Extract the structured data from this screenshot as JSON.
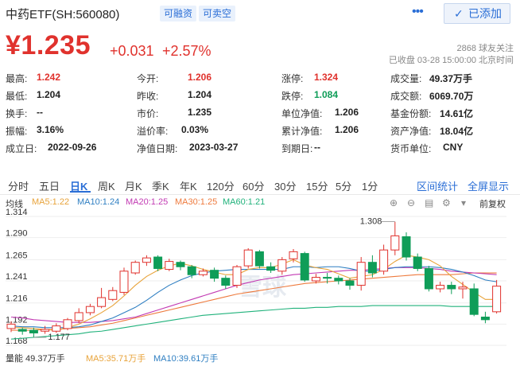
{
  "header": {
    "title": "中药ETF(SH:560080)",
    "tag_margin": "可融资",
    "tag_short": "可卖空",
    "more_icon": "more-icon",
    "added_label": "已添加"
  },
  "quote": {
    "price": "¥1.235",
    "change": "+0.031",
    "change_pct": "+2.57%",
    "followers": "2868 球友关注",
    "status": "已收盘 03-28 15:00:00 北京时间"
  },
  "stats": [
    {
      "label": "最高:",
      "value": "1.242",
      "tone": "red"
    },
    {
      "label": "今开:",
      "value": "1.206",
      "tone": "red"
    },
    {
      "label": "涨停:",
      "value": "1.324",
      "tone": "red"
    },
    {
      "label": "成交量:",
      "value": "49.37万手",
      "tone": "dark"
    },
    {
      "label": "最低:",
      "value": "1.204",
      "tone": "dark"
    },
    {
      "label": "昨收:",
      "value": "1.204",
      "tone": "dark"
    },
    {
      "label": "跌停:",
      "value": "1.084",
      "tone": "green"
    },
    {
      "label": "成交额:",
      "value": "6069.70万",
      "tone": "dark"
    },
    {
      "label": "换手:",
      "value": "--",
      "tone": "dark"
    },
    {
      "label": "市价:",
      "value": "1.235",
      "tone": "dark"
    },
    {
      "label": "单位净值:",
      "value": "1.206",
      "tone": "dark"
    },
    {
      "label": "基金份额:",
      "value": "14.61亿",
      "tone": "dark"
    },
    {
      "label": "振幅:",
      "value": "3.16%",
      "tone": "dark"
    },
    {
      "label": "溢价率:",
      "value": "0.03%",
      "tone": "dark"
    },
    {
      "label": "累计净值:",
      "value": "1.206",
      "tone": "dark"
    },
    {
      "label": "资产净值:",
      "value": "18.04亿",
      "tone": "dark"
    },
    {
      "label": "成立日:",
      "value": "2022-09-26",
      "tone": "dark"
    },
    {
      "label": "净值日期:",
      "value": "2023-03-27",
      "tone": "dark"
    },
    {
      "label": "到期日:",
      "value": "--",
      "tone": "dark"
    },
    {
      "label": "货币单位:",
      "value": "CNY",
      "tone": "dark"
    }
  ],
  "tabs": [
    "分时",
    "五日",
    "日K",
    "周K",
    "月K",
    "季K",
    "年K",
    "120分",
    "60分",
    "30分",
    "15分",
    "5分",
    "1分"
  ],
  "active_tab": "日K",
  "links": {
    "interval_stats": "区间统计",
    "fullscreen": "全屏显示"
  },
  "chart_toolbar": {
    "mode": "均线",
    "adjust": "前复权"
  },
  "ma_legend": [
    {
      "text": "MA5:1.22",
      "color": "#e8a33a"
    },
    {
      "text": "MA10:1.24",
      "color": "#2f7fc2"
    },
    {
      "text": "MA20:1.25",
      "color": "#c23ab3"
    },
    {
      "text": "MA30:1.25",
      "color": "#ee7a3d"
    },
    {
      "text": "MA60:1.21",
      "color": "#20b27b"
    }
  ],
  "volume_legend": [
    {
      "text": "量能 49.37万手",
      "color": "#333333"
    },
    {
      "text": "MA5:35.71万手",
      "color": "#e8a33a"
    },
    {
      "text": "MA10:39.61万手",
      "color": "#2f7fc2"
    }
  ],
  "colors": {
    "up": "#e0322d",
    "down": "#0f9d58",
    "accent": "#2a6ed6"
  },
  "watermark": "雪球",
  "chart_data": {
    "type": "candlestick",
    "y_ticks": [
      "1.314",
      "1.290",
      "1.265",
      "1.241",
      "1.216",
      "1.192",
      "1.168"
    ],
    "ylim": [
      1.168,
      1.314
    ],
    "high_label": "1.308",
    "low_label": "1.177",
    "ohlc": [
      [
        1.187,
        1.192,
        1.183,
        1.195
      ],
      [
        1.186,
        1.184,
        1.18,
        1.188
      ],
      [
        1.185,
        1.182,
        1.177,
        1.188
      ],
      [
        1.184,
        1.186,
        1.181,
        1.19
      ],
      [
        1.184,
        1.19,
        1.182,
        1.193
      ],
      [
        1.187,
        1.197,
        1.185,
        1.199
      ],
      [
        1.196,
        1.205,
        1.193,
        1.21
      ],
      [
        1.205,
        1.212,
        1.202,
        1.215
      ],
      [
        1.212,
        1.222,
        1.21,
        1.233
      ],
      [
        1.22,
        1.23,
        1.218,
        1.234
      ],
      [
        1.228,
        1.252,
        1.225,
        1.256
      ],
      [
        1.25,
        1.262,
        1.248,
        1.264
      ],
      [
        1.262,
        1.267,
        1.258,
        1.27
      ],
      [
        1.268,
        1.255,
        1.252,
        1.27
      ],
      [
        1.254,
        1.263,
        1.252,
        1.266
      ],
      [
        1.262,
        1.257,
        1.253,
        1.264
      ],
      [
        1.257,
        1.248,
        1.244,
        1.259
      ],
      [
        1.248,
        1.252,
        1.246,
        1.255
      ],
      [
        1.253,
        1.244,
        1.24,
        1.256
      ],
      [
        1.244,
        1.236,
        1.232,
        1.247
      ],
      [
        1.236,
        1.257,
        1.233,
        1.259
      ],
      [
        1.258,
        1.276,
        1.255,
        1.278
      ],
      [
        1.274,
        1.258,
        1.255,
        1.276
      ],
      [
        1.257,
        1.253,
        1.25,
        1.262
      ],
      [
        1.252,
        1.265,
        1.248,
        1.268
      ],
      [
        1.266,
        1.274,
        1.262,
        1.277
      ],
      [
        1.272,
        1.242,
        1.24,
        1.274
      ],
      [
        1.241,
        1.245,
        1.238,
        1.249
      ],
      [
        1.245,
        1.244,
        1.238,
        1.25
      ],
      [
        1.244,
        1.241,
        1.237,
        1.247
      ],
      [
        1.241,
        1.236,
        1.231,
        1.244
      ],
      [
        1.236,
        1.262,
        1.23,
        1.268
      ],
      [
        1.262,
        1.25,
        1.245,
        1.27
      ],
      [
        1.252,
        1.276,
        1.248,
        1.282
      ],
      [
        1.276,
        1.292,
        1.27,
        1.308
      ],
      [
        1.291,
        1.268,
        1.264,
        1.296
      ],
      [
        1.268,
        1.255,
        1.252,
        1.272
      ],
      [
        1.255,
        1.232,
        1.229,
        1.258
      ],
      [
        1.232,
        1.236,
        1.228,
        1.24
      ],
      [
        1.236,
        1.232,
        1.226,
        1.24
      ],
      [
        1.232,
        1.234,
        1.221,
        1.24
      ],
      [
        1.232,
        1.203,
        1.201,
        1.238
      ],
      [
        1.2,
        1.197,
        1.193,
        1.206
      ],
      [
        1.206,
        1.235,
        1.204,
        1.242
      ]
    ],
    "ma5": [
      1.188,
      1.188,
      1.187,
      1.186,
      1.185,
      1.188,
      1.192,
      1.198,
      1.205,
      1.213,
      1.224,
      1.236,
      1.246,
      1.253,
      1.258,
      1.261,
      1.258,
      1.254,
      1.251,
      1.248,
      1.248,
      1.254,
      1.256,
      1.256,
      1.26,
      1.265,
      1.259,
      1.256,
      1.254,
      1.249,
      1.244,
      1.246,
      1.248,
      1.254,
      1.263,
      1.27,
      1.268,
      1.265,
      1.258,
      1.246,
      1.237,
      1.228,
      1.22,
      1.22
    ],
    "ma10": [
      1.19,
      1.189,
      1.189,
      1.188,
      1.188,
      1.188,
      1.189,
      1.191,
      1.195,
      1.199,
      1.205,
      1.211,
      1.219,
      1.228,
      1.236,
      1.242,
      1.247,
      1.25,
      1.252,
      1.253,
      1.254,
      1.254,
      1.254,
      1.254,
      1.254,
      1.257,
      1.257,
      1.256,
      1.257,
      1.257,
      1.255,
      1.252,
      1.252,
      1.254,
      1.256,
      1.257,
      1.257,
      1.257,
      1.256,
      1.254,
      1.251,
      1.247,
      1.242,
      1.24
    ],
    "ma20": [
      1.2,
      1.199,
      1.197,
      1.196,
      1.195,
      1.194,
      1.194,
      1.194,
      1.195,
      1.196,
      1.198,
      1.2,
      1.204,
      1.208,
      1.212,
      1.216,
      1.22,
      1.224,
      1.228,
      1.232,
      1.236,
      1.239,
      1.242,
      1.244,
      1.246,
      1.248,
      1.249,
      1.25,
      1.251,
      1.252,
      1.253,
      1.253,
      1.254,
      1.255,
      1.256,
      1.256,
      1.256,
      1.255,
      1.254,
      1.252,
      1.251,
      1.25,
      1.249,
      1.248
    ],
    "ma30": [
      1.185,
      1.185,
      1.185,
      1.186,
      1.186,
      1.187,
      1.188,
      1.189,
      1.191,
      1.193,
      1.196,
      1.199,
      1.202,
      1.205,
      1.208,
      1.211,
      1.214,
      1.217,
      1.22,
      1.223,
      1.226,
      1.228,
      1.23,
      1.232,
      1.234,
      1.236,
      1.238,
      1.239,
      1.24,
      1.241,
      1.242,
      1.243,
      1.244,
      1.245,
      1.246,
      1.247,
      1.248,
      1.248,
      1.248,
      1.248,
      1.249,
      1.25,
      1.25,
      1.25
    ],
    "ma60": [
      1.175,
      1.176,
      1.177,
      1.178,
      1.179,
      1.18,
      1.181,
      1.183,
      1.184,
      1.186,
      1.188,
      1.19,
      1.192,
      1.194,
      1.196,
      1.198,
      1.2,
      1.202,
      1.203,
      1.204,
      1.205,
      1.206,
      1.207,
      1.208,
      1.209,
      1.21,
      1.21,
      1.211,
      1.211,
      1.212,
      1.212,
      1.212,
      1.213,
      1.213,
      1.213,
      1.213,
      1.213,
      1.213,
      1.213,
      1.212,
      1.212,
      1.212,
      1.212,
      1.212
    ]
  }
}
